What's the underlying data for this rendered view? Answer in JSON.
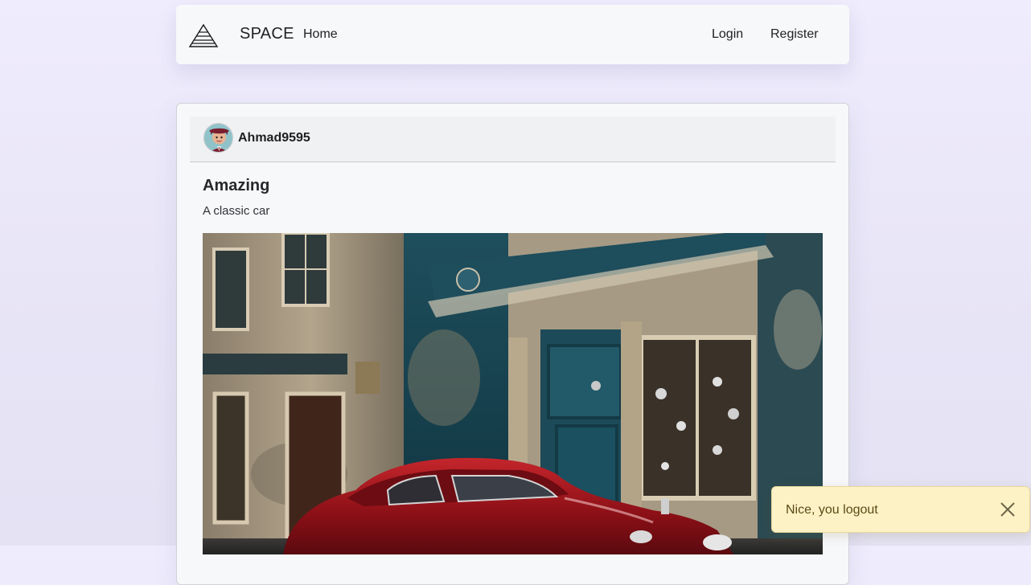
{
  "navbar": {
    "brand_icon": "triangle-logo-icon",
    "brand_name": "SPACE",
    "home_label": "Home",
    "login_label": "Login",
    "register_label": "Register"
  },
  "post": {
    "author": {
      "avatar_icon": "user-avatar",
      "username": "Ahmad9595"
    },
    "title": "Amazing",
    "body": "A classic car",
    "image_alt": "A classic red car parked in front of a vintage storefront"
  },
  "toast": {
    "message": "Nice, you logout",
    "close_icon": "close-icon",
    "color": "#fdf2c6"
  }
}
